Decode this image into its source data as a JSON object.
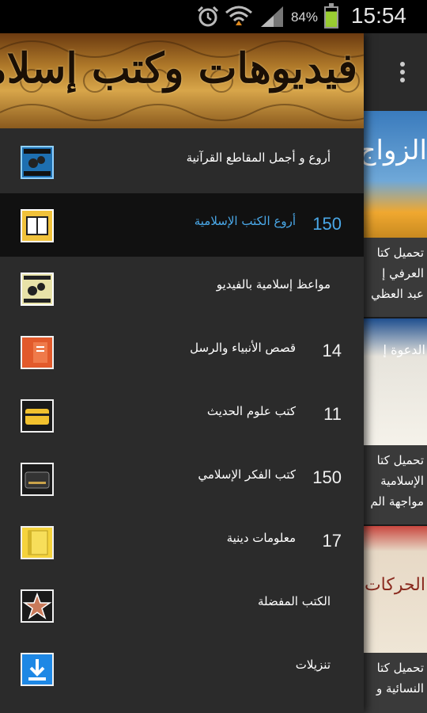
{
  "status_bar": {
    "battery_percent": "84%",
    "time": "15:54",
    "icons": [
      "alarm-icon",
      "wifi-icon",
      "signal-icon",
      "battery-icon"
    ]
  },
  "drawer": {
    "header_title": "فيديوهات وكتب إسلامية",
    "items": [
      {
        "label": "أروع و أجمل المقاطع القرآنية",
        "count": "",
        "icon": "film-icon",
        "active": false
      },
      {
        "label": "أروع الكتب الإسلامية",
        "count": "150",
        "icon": "book-icon",
        "active": true
      },
      {
        "label": "مواعظ إسلامية بالفيديو",
        "count": "",
        "icon": "video-icon",
        "active": false
      },
      {
        "label": "قصص الأنبياء والرسل",
        "count": "14",
        "icon": "prophets-book-icon",
        "active": false
      },
      {
        "label": "كتب علوم الحديث",
        "count": "11",
        "icon": "hadith-book-icon",
        "active": false
      },
      {
        "label": "كتب الفكر الإسلامي",
        "count": "150",
        "icon": "thought-book-icon",
        "active": false
      },
      {
        "label": "معلومات دينية",
        "count": "17",
        "icon": "info-notebook-icon",
        "active": false
      },
      {
        "label": "الكتب المفضلة",
        "count": "",
        "icon": "star-icon",
        "active": false
      },
      {
        "label": "تنزيلات",
        "count": "",
        "icon": "download-icon",
        "active": false
      }
    ]
  },
  "background_cards": [
    {
      "cover_text": "الزواج",
      "caption_lines": [
        "تحميل كتا",
        "العرفي إ",
        "عبد العظي"
      ]
    },
    {
      "cover_text": "الدعوة إ",
      "caption_lines": [
        "تحميل كتا",
        "الإسلامية",
        "مواجهة الم"
      ]
    },
    {
      "cover_text": "الحركات",
      "caption_lines": [
        "تحميل كتا",
        "النسائية و"
      ]
    }
  ],
  "colors": {
    "accent": "#4aa8e8",
    "drawer_bg": "#2b2b2b",
    "active_row_bg": "#111111"
  }
}
